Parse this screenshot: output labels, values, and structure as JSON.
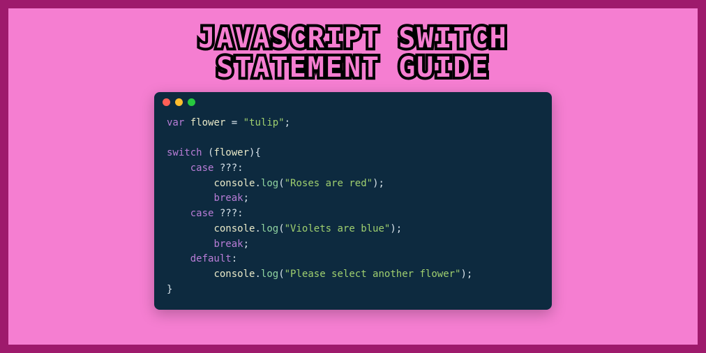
{
  "title_line1": "JAVASCRIPT SWITCH",
  "title_line2": "STATEMENT GUIDE",
  "traffic": {
    "red": "#ff5f56",
    "yellow": "#ffbd2e",
    "green": "#27c93f"
  },
  "code": {
    "l1_var": "var",
    "l1_ident": "flower",
    "l1_eq": " = ",
    "l1_str": "\"tulip\"",
    "l1_semi": ";",
    "l3_switch": "switch",
    "l3_open": " (",
    "l3_ident": "flower",
    "l3_close": "){",
    "l4_case": "case",
    "l4_rest": " ???:",
    "l5_indent": "        ",
    "l5_console": "console",
    "l5_dot": ".",
    "l5_log": "log",
    "l5_open": "(",
    "l5_str": "\"Roses are red\"",
    "l5_close": ");",
    "l6_break": "break",
    "l6_semi": ";",
    "l7_case": "case",
    "l7_rest": " ???:",
    "l8_console": "console",
    "l8_dot": ".",
    "l8_log": "log",
    "l8_open": "(",
    "l8_str": "\"Violets are blue\"",
    "l8_close": ");",
    "l9_break": "break",
    "l9_semi": ";",
    "l10_default": "default",
    "l10_colon": ":",
    "l11_console": "console",
    "l11_dot": ".",
    "l11_log": "log",
    "l11_open": "(",
    "l11_str": "\"Please select another flower\"",
    "l11_close": ");",
    "l12_brace": "}"
  }
}
